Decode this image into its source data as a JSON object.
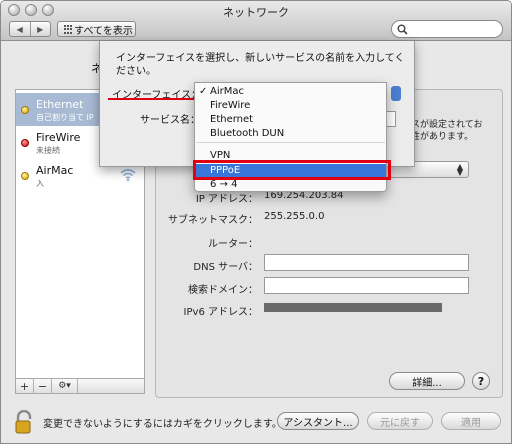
{
  "window": {
    "title": "ネットワーク"
  },
  "toolbar": {
    "back_glyph": "◀",
    "forward_glyph": "▶",
    "show_all_label": "すべてを表示",
    "search_placeholder": ""
  },
  "behind_sheet_label": "ネ",
  "services": [
    {
      "name": "Ethernet",
      "status": "自己割り当て IP",
      "status_color": "yellow",
      "selected": true,
      "icon": "ethernet-icon"
    },
    {
      "name": "FireWire",
      "status": "未接続",
      "status_color": "red",
      "selected": false,
      "icon": "firewire-icon"
    },
    {
      "name": "AirMac",
      "status": "入",
      "status_color": "yellow",
      "selected": false,
      "icon": "wifi-icon"
    }
  ],
  "list_bar": {
    "add": "+",
    "remove": "−",
    "gear": "⚙▾"
  },
  "detail": {
    "note_line1": "スが設定されてお",
    "note_line2": "性があります。",
    "ip_label": "IP アドレス：",
    "ip_value": "169.254.203.84",
    "subnet_label": "サブネットマスク：",
    "subnet_value": "255.255.0.0",
    "router_label": "ルーター：",
    "dns_label": "DNS サーバ：",
    "search_domain_label": "検索ドメイン：",
    "ipv6_label": "IPv6 アドレス："
  },
  "buttons": {
    "advanced": "詳細...",
    "help": "?",
    "assistant": "アシスタント...",
    "revert": "元に戻す",
    "apply": "適用"
  },
  "lock_text": "変更できないようにするにはカギをクリックします。",
  "sheet": {
    "message": "インターフェイスを選択し、新しいサービスの名前を入力してください。",
    "interface_label": "インターフェイス：",
    "service_name_label": "サービス名："
  },
  "menu": {
    "checkmark": "✓",
    "items_group1": [
      "AirMac",
      "FireWire",
      "Ethernet",
      "Bluetooth DUN"
    ],
    "items_group2": [
      "VPN",
      "PPPoE",
      "6 → 4"
    ],
    "highlighted": "PPPoE"
  },
  "colors": {
    "highlight_blue": "#3876d9",
    "annotation_red": "#e0000f",
    "selection_blue": "#a7b9d3"
  }
}
